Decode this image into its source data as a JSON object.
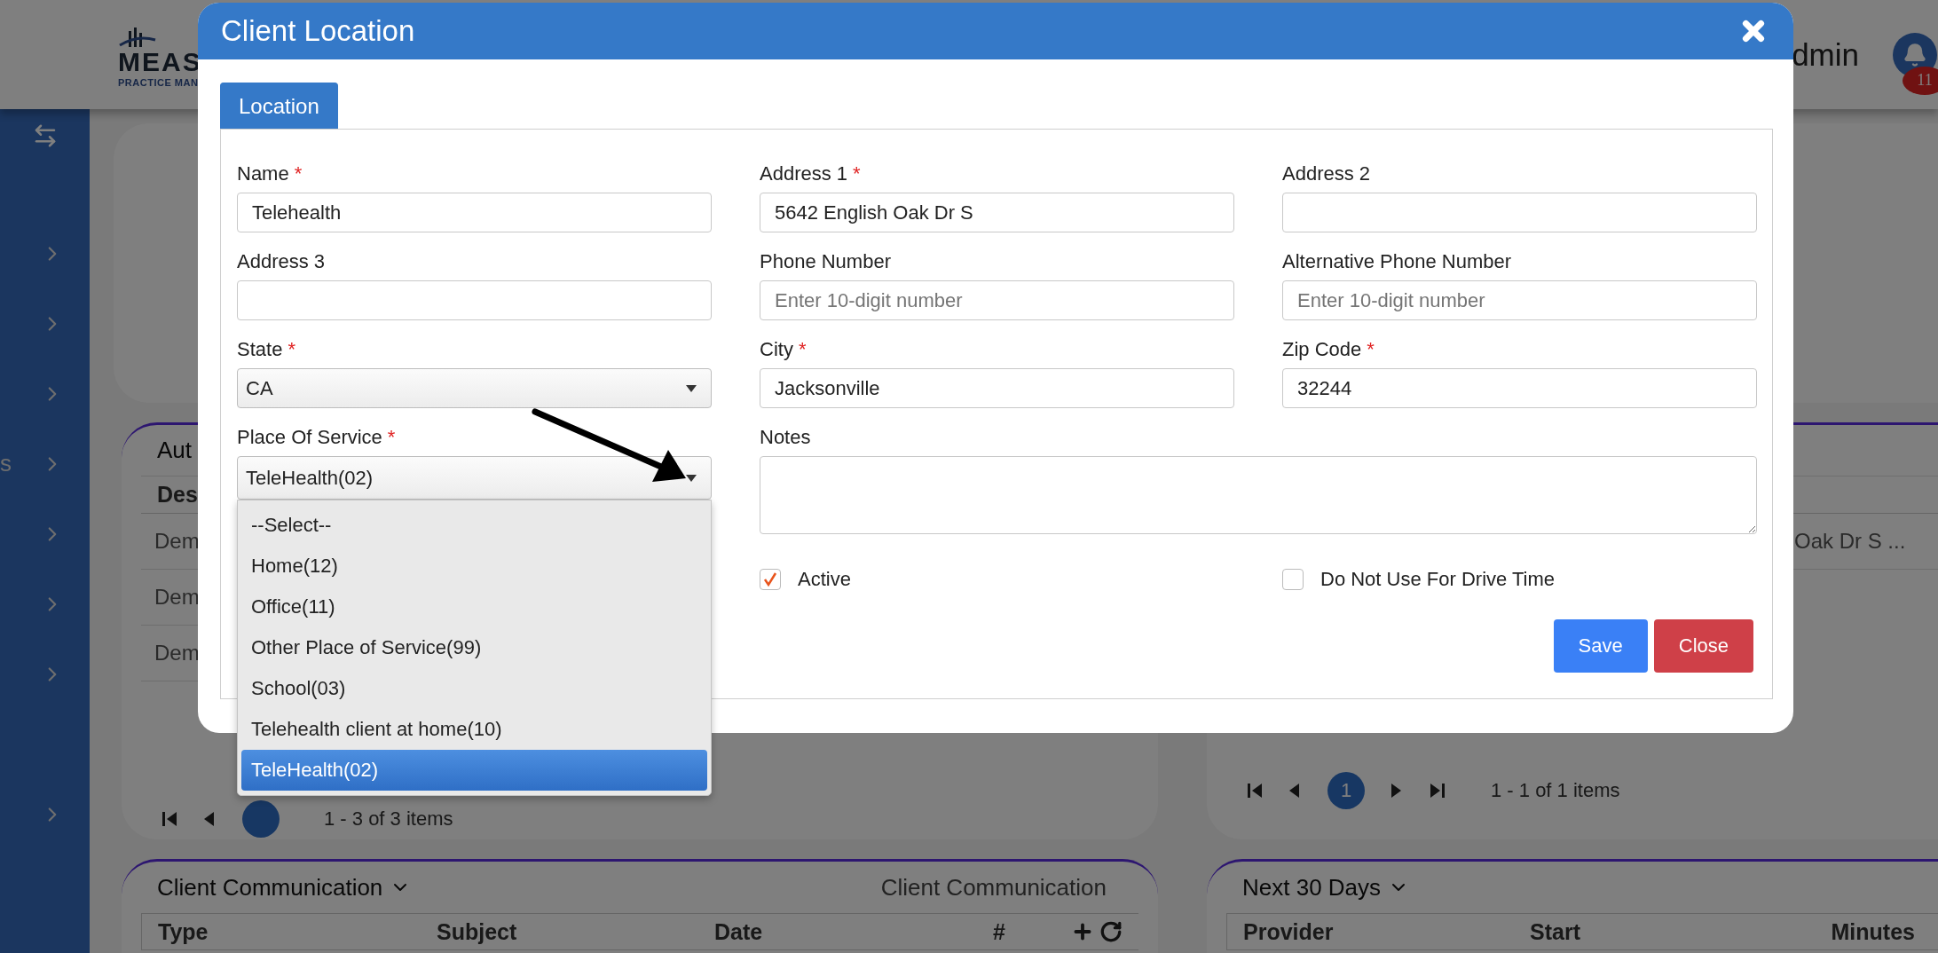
{
  "header": {
    "brand": "MEAS",
    "brand_tagline": "PRACTICE MAN",
    "user": "dmin",
    "notification_count": "11"
  },
  "sidebar": {
    "label_fragment": "s"
  },
  "background": {
    "authorization_panel": {
      "title": "Aut",
      "column_1": "Des",
      "rows": [
        "Dem",
        "Dem",
        "Dem"
      ],
      "pagination": {
        "summary": "1 - 3 of 3 items"
      }
    },
    "locations_panel": {
      "rows": [
        "Oak Dr S ..."
      ],
      "pagination": {
        "page": "1",
        "summary": "1 - 1 of 1 items"
      }
    },
    "communication_panel": {
      "title": "Client Communication",
      "caption": "Client Communication",
      "columns": [
        "Type",
        "Subject",
        "Date",
        "#"
      ]
    },
    "upcoming_panel": {
      "title": "Next 30 Days",
      "columns": [
        "Provider",
        "Start",
        "Minutes"
      ]
    }
  },
  "dialog": {
    "title": "Client Location",
    "tabs": [
      {
        "label": "Location",
        "selected": true
      }
    ],
    "fields": [
      {
        "kind": "text",
        "label": "Name",
        "required_mark": "*",
        "value": "Telehealth"
      },
      {
        "kind": "text",
        "label": "Address 1",
        "required_mark": "*",
        "value": "5642 English Oak Dr S"
      },
      {
        "kind": "text",
        "label": "Address 2"
      },
      {
        "kind": "text",
        "label": "Address 3"
      },
      {
        "kind": "text",
        "label": "Phone Number",
        "placeholder": "Enter 10-digit number"
      },
      {
        "kind": "text",
        "label": "Alternative Phone Number",
        "placeholder": "Enter 10-digit number"
      },
      {
        "kind": "select",
        "label": "State",
        "required_mark": "*",
        "value": "CA",
        "expanded": false
      },
      {
        "kind": "text",
        "label": "City",
        "required_mark": "*",
        "value": "Jacksonville"
      },
      {
        "kind": "text",
        "label": "Zip Code",
        "required_mark": "*",
        "value": "32244"
      },
      {
        "kind": "select",
        "label": "Place Of Service",
        "required_mark": "*",
        "value": "TeleHealth(02)",
        "expanded": true,
        "options": [
          {
            "label": "--Select--",
            "selected": false
          },
          {
            "label": "Home(12)",
            "selected": false
          },
          {
            "label": "Office(11)",
            "selected": false
          },
          {
            "label": "Other Place of Service(99)",
            "selected": false
          },
          {
            "label": "School(03)",
            "selected": false
          },
          {
            "label": "Telehealth client at home(10)",
            "selected": false
          },
          {
            "label": "TeleHealth(02)",
            "selected": true
          }
        ]
      },
      {
        "kind": "textarea",
        "label": "Notes"
      }
    ],
    "checkboxes": [
      {
        "label": "Active",
        "checked": true
      },
      {
        "label": "Do Not Use For Drive Time",
        "checked": false
      }
    ],
    "buttons": [
      {
        "label": "Save",
        "kind": "primary"
      },
      {
        "label": "Close",
        "kind": "danger"
      }
    ]
  }
}
